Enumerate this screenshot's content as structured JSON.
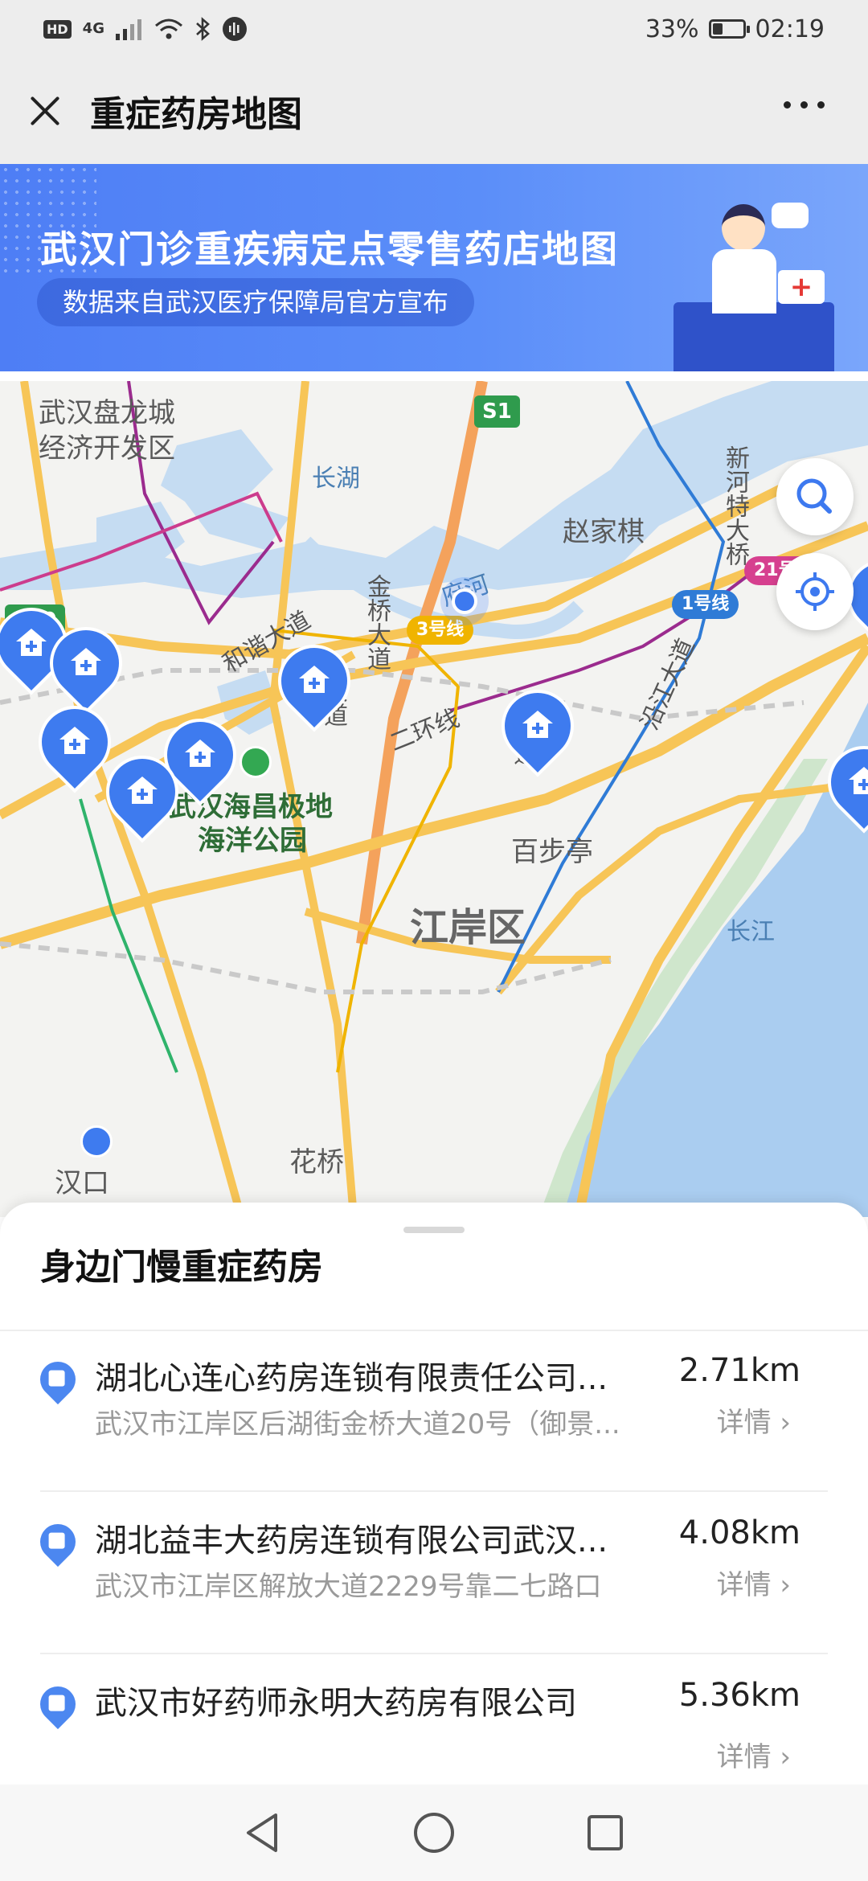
{
  "status_bar": {
    "hd": "HD",
    "network": "4G",
    "battery_percent_text": "33%",
    "battery_level": 0.33,
    "time": "02:19",
    "icons": [
      "signal-icon",
      "wifi-icon",
      "bluetooth-icon",
      "voice-icon"
    ]
  },
  "header": {
    "title": "重症药房地图",
    "close_icon": "close-icon",
    "more_icon": "more-icon"
  },
  "banner": {
    "title": "武汉门诊重疾病定点零售药店地图",
    "subtitle": "数据来自武汉医疗保障局官方宣布"
  },
  "map": {
    "labels": {
      "panlong": "武汉盘龙城",
      "panlong2": "经济开发区",
      "changhu": "长湖",
      "zhaojiaqi": "赵家棋",
      "fuhe": "府河",
      "haichang": "武汉海昌极地",
      "haichang2": "海洋公园",
      "baibuting": "百步亭",
      "jiangan": "江岸区",
      "changjiang": "长江",
      "huaqiao": "花桥",
      "hankou": "汉口",
      "xinhe": "新河特大桥",
      "jinqiao": "金桥大道",
      "hexie": "和谐大道",
      "erhuan": "二环线",
      "yanjiang": "沿江大道",
      "dadao": "大道",
      "dao": "道"
    },
    "road_badges": {
      "s1": "S1",
      "s19": "S19"
    },
    "metro_badges": {
      "line1": "1号线",
      "line3": "3号线",
      "line21": "21号线"
    },
    "search_icon": "search-icon",
    "locate_icon": "locate-icon",
    "colors": {
      "water": "#c5dcf2",
      "green": "#cfe6cc",
      "road": "#f7c557",
      "metro_purple": "#9b2b8e",
      "pin": "#3e7bef"
    }
  },
  "sheet": {
    "title": "身边门慢重症药房",
    "items": [
      {
        "name": "湖北心连心药房连锁有限责任公司...",
        "address": "武汉市江岸区后湖街金桥大道20号（御景...",
        "distance": "2.71km",
        "detail": "详情"
      },
      {
        "name": "湖北益丰大药房连锁有限公司武汉...",
        "address": "武汉市江岸区解放大道2229号靠二七路口",
        "distance": "4.08km",
        "detail": "详情"
      },
      {
        "name": "武汉市好药师永明大药房有限公司",
        "address": "",
        "distance": "5.36km",
        "detail": "详情"
      }
    ]
  },
  "nav": {
    "back_icon": "back-icon",
    "home_icon": "home-icon",
    "recents_icon": "recents-icon"
  }
}
